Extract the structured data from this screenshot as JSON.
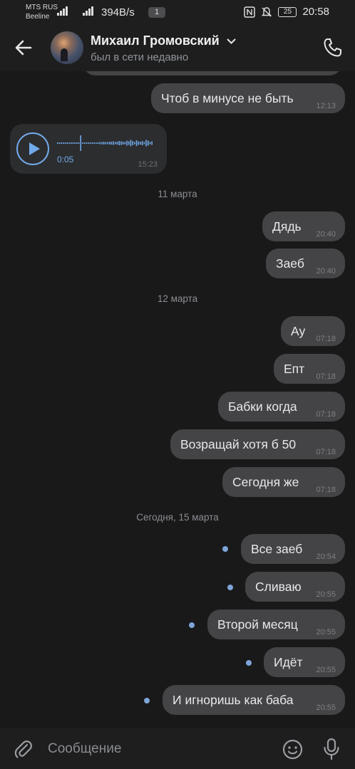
{
  "statusbar": {
    "carrier1": "MTS RUS",
    "carrier2": "Beeline",
    "speed": "394B/s",
    "notif_count": "1",
    "battery": "25",
    "time": "20:58"
  },
  "header": {
    "contact_name": "Михаил Громовский",
    "status": "был в сети недавно"
  },
  "voice": {
    "duration": "0:05",
    "time": "15:23"
  },
  "dates": [
    "11 марта",
    "12 марта",
    "Сегодня, 15 марта"
  ],
  "messages": [
    {
      "text": "Чтоб в минусе не быть",
      "time": "12:13"
    },
    {
      "text": "Дядь",
      "time": "20:40"
    },
    {
      "text": "Заеб",
      "time": "20:40"
    },
    {
      "text": "Ау",
      "time": "07:18"
    },
    {
      "text": "Епт",
      "time": "07:18"
    },
    {
      "text": "Бабки когда",
      "time": "07:18"
    },
    {
      "text": "Возращай хотя б 50",
      "time": "07:18"
    },
    {
      "text": "Сегодня же",
      "time": "07:18"
    },
    {
      "text": "Все заеб",
      "time": "20:54"
    },
    {
      "text": "Сливаю",
      "time": "20:55"
    },
    {
      "text": "Второй месяц",
      "time": "20:55"
    },
    {
      "text": "Идёт",
      "time": "20:55"
    },
    {
      "text": "И игноришь как баба",
      "time": "20:55"
    }
  ],
  "composer": {
    "placeholder": "Сообщение"
  },
  "icons": {
    "back": "arrow-left-icon",
    "call": "phone-icon",
    "attach": "paperclip-icon",
    "emoji": "smiley-icon",
    "mic": "microphone-icon",
    "play": "play-icon"
  },
  "colors": {
    "background": "#19191a",
    "bubble": "#444446",
    "accent": "#71aaeb",
    "unread_dot": "#7ea5d8"
  }
}
